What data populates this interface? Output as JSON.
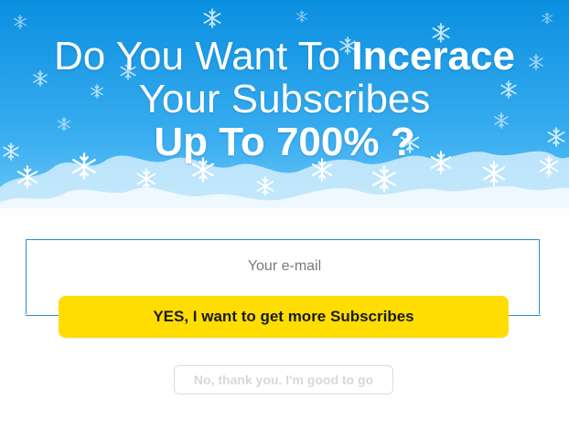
{
  "headline": {
    "line1_regular": "Do You Want To ",
    "line1_bold": "Incerace",
    "line2": "Your Subscribes",
    "line3": "Up To 700% ?"
  },
  "form": {
    "email_placeholder": "Your e-mail",
    "submit_label": "YES, I want to get more Subscribes",
    "decline_label": "No, thank you. I'm good to go"
  },
  "colors": {
    "banner_top": "#0a8fe0",
    "banner_bottom": "#5cc0f5",
    "accent_border": "#2b8ccc",
    "cta_yellow": "#ffdd00"
  },
  "icons": [
    "snowflake-icon"
  ]
}
